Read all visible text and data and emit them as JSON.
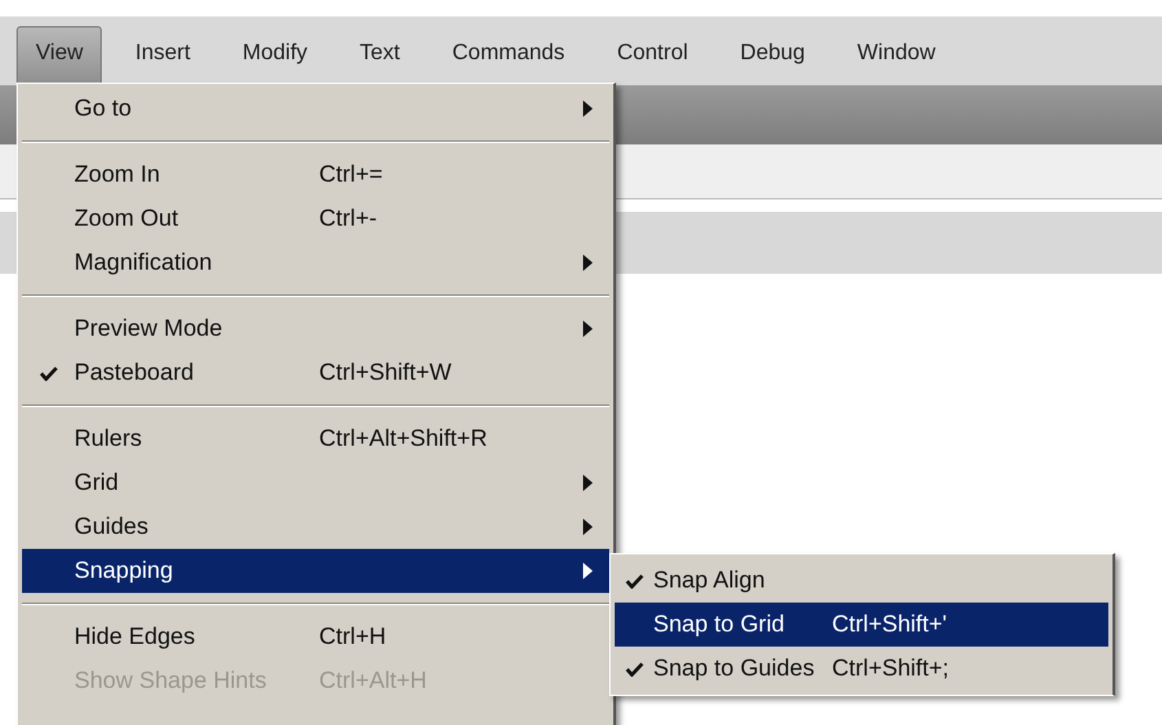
{
  "menubar": [
    {
      "label": "View",
      "selected": true
    },
    {
      "label": "Insert",
      "selected": false
    },
    {
      "label": "Modify",
      "selected": false
    },
    {
      "label": "Text",
      "selected": false
    },
    {
      "label": "Commands",
      "selected": false
    },
    {
      "label": "Control",
      "selected": false
    },
    {
      "label": "Debug",
      "selected": false
    },
    {
      "label": "Window",
      "selected": false
    }
  ],
  "view_menu": [
    {
      "kind": "item",
      "label": "Go to",
      "submenu": true,
      "checked": false,
      "selected": false,
      "disabled": false
    },
    {
      "kind": "separator"
    },
    {
      "kind": "item",
      "label": "Zoom In",
      "shortcut": "Ctrl+=",
      "submenu": false,
      "checked": false,
      "selected": false,
      "disabled": false
    },
    {
      "kind": "item",
      "label": "Zoom Out",
      "shortcut": "Ctrl+-",
      "submenu": false,
      "checked": false,
      "selected": false,
      "disabled": false
    },
    {
      "kind": "item",
      "label": "Magnification",
      "submenu": true,
      "checked": false,
      "selected": false,
      "disabled": false
    },
    {
      "kind": "separator"
    },
    {
      "kind": "item",
      "label": "Preview Mode",
      "submenu": true,
      "checked": false,
      "selected": false,
      "disabled": false
    },
    {
      "kind": "item",
      "label": "Pasteboard",
      "shortcut": "Ctrl+Shift+W",
      "submenu": false,
      "checked": true,
      "selected": false,
      "disabled": false
    },
    {
      "kind": "separator"
    },
    {
      "kind": "item",
      "label": "Rulers",
      "shortcut": "Ctrl+Alt+Shift+R",
      "submenu": false,
      "checked": false,
      "selected": false,
      "disabled": false
    },
    {
      "kind": "item",
      "label": "Grid",
      "submenu": true,
      "checked": false,
      "selected": false,
      "disabled": false
    },
    {
      "kind": "item",
      "label": "Guides",
      "submenu": true,
      "checked": false,
      "selected": false,
      "disabled": false
    },
    {
      "kind": "item",
      "label": "Snapping",
      "submenu": true,
      "checked": false,
      "selected": true,
      "disabled": false
    },
    {
      "kind": "separator"
    },
    {
      "kind": "item",
      "label": "Hide Edges",
      "shortcut": "Ctrl+H",
      "submenu": false,
      "checked": false,
      "selected": false,
      "disabled": false
    },
    {
      "kind": "item",
      "label": "Show Shape Hints",
      "shortcut": "Ctrl+Alt+H",
      "submenu": false,
      "checked": false,
      "selected": false,
      "disabled": true
    }
  ],
  "snapping_submenu": [
    {
      "label": "Snap Align",
      "checked": true,
      "selected": false
    },
    {
      "label": "Snap to Grid",
      "shortcut": "Ctrl+Shift+'",
      "checked": false,
      "selected": true
    },
    {
      "label": "Snap to Guides",
      "shortcut": "Ctrl+Shift+;",
      "checked": true,
      "selected": false
    }
  ]
}
